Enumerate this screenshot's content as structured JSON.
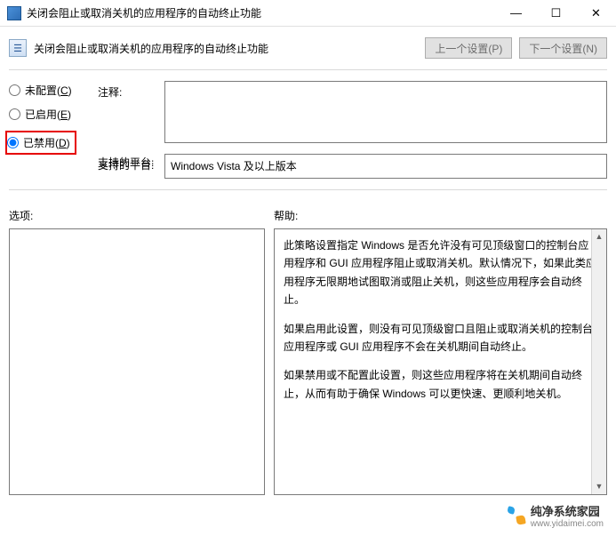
{
  "window": {
    "title": "关闭会阻止或取消关机的应用程序的自动终止功能"
  },
  "header": {
    "subtitle": "关闭会阻止或取消关机的应用程序的自动终止功能",
    "prev_button": "上一个设置(P)",
    "next_button": "下一个设置(N)"
  },
  "radios": {
    "not_configured": "未配置(",
    "not_configured_key": "C",
    "enabled": "已启用(",
    "enabled_key": "E",
    "disabled": "已禁用(",
    "disabled_key": "D",
    "close_paren": ")"
  },
  "labels": {
    "comment": "注释:",
    "supported_on": "支持的平台:",
    "options": "选项:",
    "help": "帮助:"
  },
  "fields": {
    "comment_value": "",
    "supported_on_value": "Windows Vista 及以上版本"
  },
  "help": {
    "p1": "此策略设置指定 Windows 是否允许没有可见顶级窗口的控制台应用程序和 GUI 应用程序阻止或取消关机。默认情况下，如果此类应用程序无限期地试图取消或阻止关机，则这些应用程序会自动终止。",
    "p2": "如果启用此设置，则没有可见顶级窗口且阻止或取消关机的控制台应用程序或 GUI 应用程序不会在关机期间自动终止。",
    "p3": "如果禁用或不配置此设置，则这些应用程序将在关机期间自动终止，从而有助于确保 Windows 可以更快速、更顺利地关机。"
  },
  "watermark": {
    "text": "纯净系统家园",
    "url": "www.yidaimei.com"
  }
}
